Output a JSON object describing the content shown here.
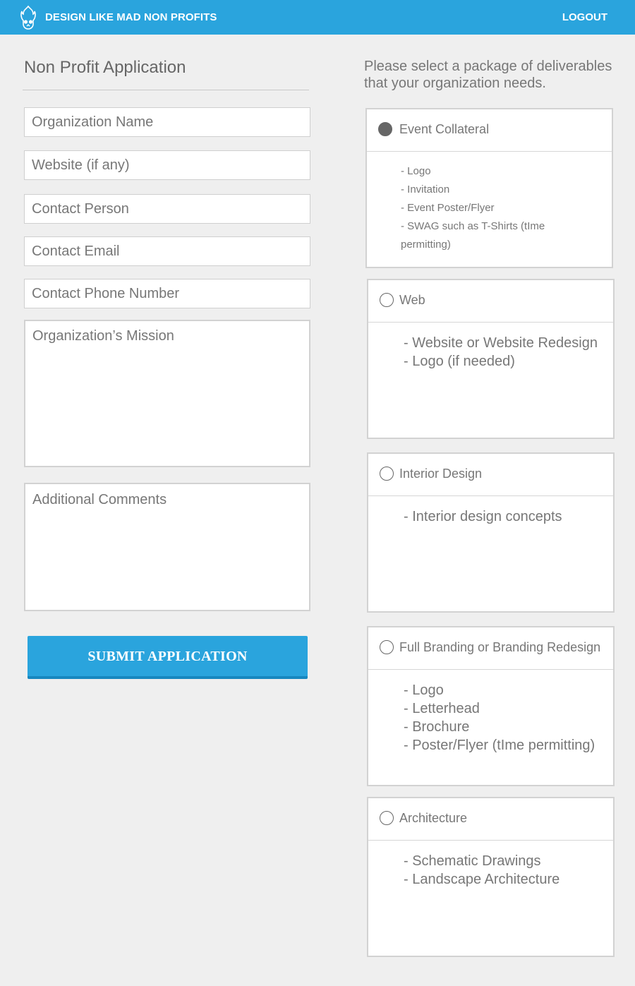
{
  "header": {
    "brand": "DESIGN LIKE MAD NON PROFITS",
    "logout": "LOGOUT",
    "color": "#2aa4dd"
  },
  "form": {
    "title": "Non Profit Application",
    "fields": {
      "org_name": "Organization Name",
      "website": "Website (if any)",
      "contact_person": "Contact Person",
      "contact_email": "Contact Email",
      "contact_phone": "Contact Phone Number",
      "mission": "Organization’s Mission",
      "comments": "Additional Comments"
    },
    "submit": "SUBMIT APPLICATION"
  },
  "packages": {
    "instructions": "Please select a package of deliverables that your organization needs.",
    "items": [
      {
        "name": "Event Collateral",
        "selected": true,
        "lines": [
          "- Logo",
          "- Invitation",
          "- Event Poster/Flyer",
          "- SWAG such as T-Shirts (tIme",
          "permitting)"
        ]
      },
      {
        "name": "Web",
        "selected": false,
        "lines": [
          "- Website or Website Redesign",
          "- Logo (if needed)"
        ]
      },
      {
        "name": "Interior Design",
        "selected": false,
        "lines": [
          "- Interior design concepts"
        ]
      },
      {
        "name": "Full Branding or Branding Redesign",
        "selected": false,
        "lines": [
          "- Logo",
          "- Letterhead",
          "- Brochure",
          "- Poster/Flyer (tIme permitting)"
        ]
      },
      {
        "name": "Architecture",
        "selected": false,
        "lines": [
          "- Schematic Drawings",
          "- Landscape Architecture"
        ]
      }
    ]
  }
}
